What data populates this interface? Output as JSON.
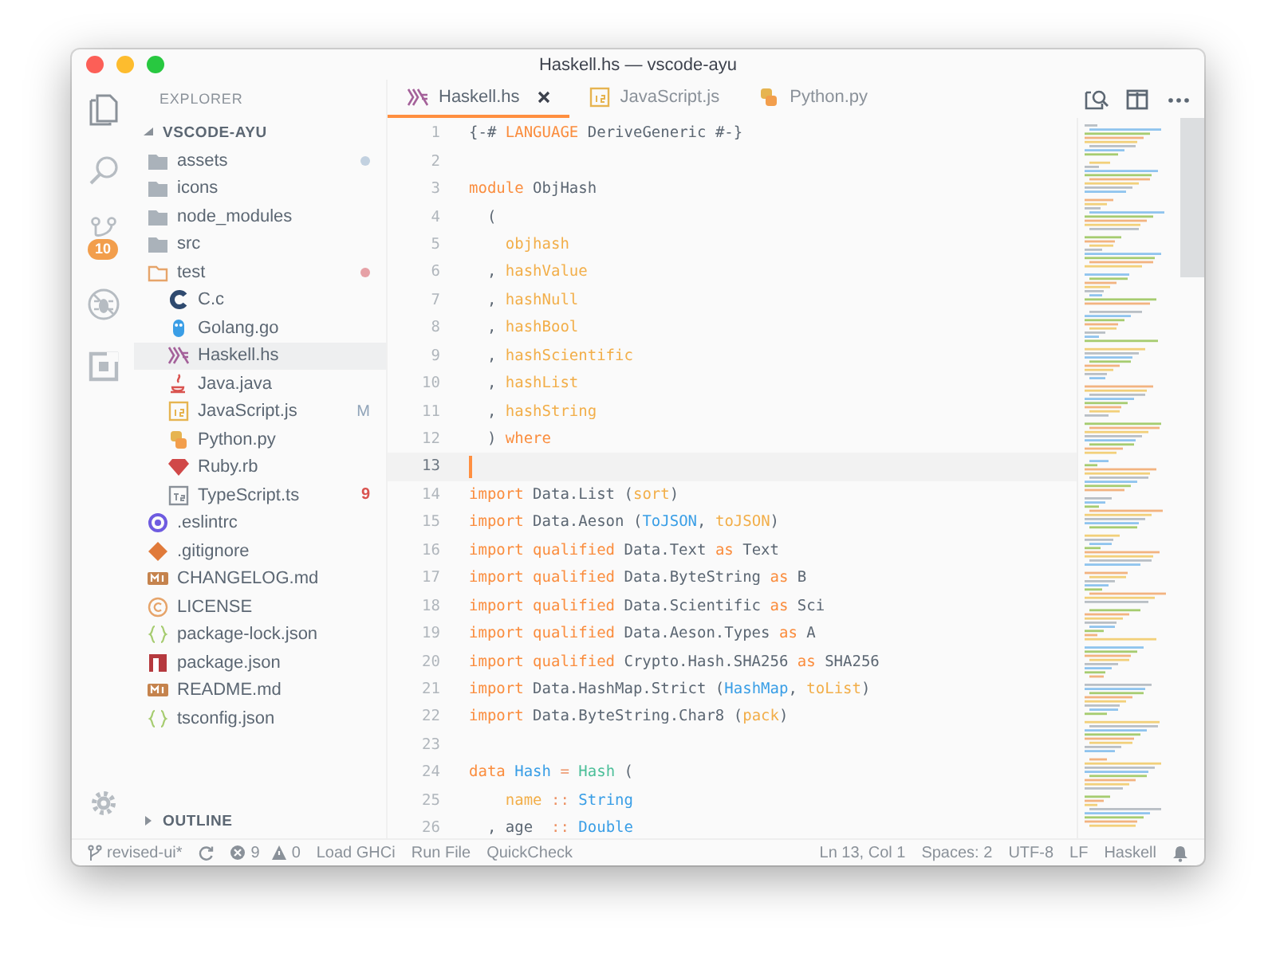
{
  "window": {
    "title": "Haskell.hs — vscode-ayu"
  },
  "activity_bar": {
    "items": [
      {
        "kind": "files",
        "selected": true
      },
      {
        "kind": "search",
        "selected": false
      },
      {
        "kind": "branch",
        "selected": false,
        "badge": "10"
      },
      {
        "kind": "debug",
        "selected": false
      },
      {
        "kind": "extensions",
        "selected": false
      }
    ]
  },
  "sidebar": {
    "header": "EXPLORER",
    "root": {
      "label": "VSCODE-AYU",
      "expanded": true
    },
    "items": [
      {
        "label": "assets",
        "kind": "folder",
        "expanded": false,
        "selected": false,
        "color": "#c2d1e0"
      },
      {
        "label": "icons",
        "kind": "folder",
        "expanded": false,
        "selected": false
      },
      {
        "label": "node_modules",
        "kind": "folder",
        "expanded": false,
        "selected": false
      },
      {
        "label": "src",
        "kind": "folder",
        "expanded": false,
        "selected": false
      },
      {
        "label": "test",
        "kind": "folder",
        "expanded": true,
        "selected": false,
        "color": "#e6a1a6",
        "children": [
          {
            "label": "C.c",
            "kind": "c",
            "selected": false
          },
          {
            "label": "Golang.go",
            "kind": "go",
            "selected": false
          },
          {
            "label": "Haskell.hs",
            "kind": "haskell",
            "selected": true
          },
          {
            "label": "Java.java",
            "kind": "java",
            "selected": false
          },
          {
            "label": "JavaScript.js",
            "kind": "js",
            "selected": false,
            "git_status": "M"
          },
          {
            "label": "Python.py",
            "kind": "python",
            "selected": false
          },
          {
            "label": "Ruby.rb",
            "kind": "ruby",
            "selected": false
          },
          {
            "label": "TypeScript.ts",
            "kind": "ts",
            "selected": false,
            "problems": "9"
          }
        ]
      },
      {
        "label": ".eslintrc",
        "kind": "eslint",
        "selected": false
      },
      {
        "label": ".gitignore",
        "kind": "git",
        "selected": false
      },
      {
        "label": "CHANGELOG.md",
        "kind": "markdown",
        "selected": false
      },
      {
        "label": "LICENSE",
        "kind": "license",
        "selected": false
      },
      {
        "label": "package-lock.json",
        "kind": "json",
        "selected": false
      },
      {
        "label": "package.json",
        "kind": "npm",
        "selected": false
      },
      {
        "label": "README.md",
        "kind": "markdown",
        "selected": false
      },
      {
        "label": "tsconfig.json",
        "kind": "json",
        "selected": false
      }
    ],
    "outline": {
      "label": "OUTLINE",
      "expanded": false
    }
  },
  "tabs": [
    {
      "label": "Haskell.hs",
      "kind": "haskell",
      "selected": true
    },
    {
      "label": "JavaScript.js",
      "kind": "js",
      "selected": false
    },
    {
      "label": "Python.py",
      "kind": "python",
      "selected": false
    }
  ],
  "code": [
    {
      "number": "1",
      "current": false,
      "tokens": [
        {
          "kind": "plain",
          "text": "{-# "
        },
        {
          "kind": "keyword",
          "text": "LANGUAGE"
        },
        {
          "kind": "plain",
          "text": " DeriveGeneric #-}"
        }
      ]
    },
    {
      "number": "2",
      "current": false
    },
    {
      "number": "3",
      "current": false,
      "tokens": [
        {
          "kind": "keyword",
          "text": "module"
        },
        {
          "kind": "plain",
          "text": " ObjHash"
        }
      ]
    },
    {
      "number": "4",
      "current": false,
      "tokens": [
        {
          "kind": "plain",
          "text": "  ("
        }
      ]
    },
    {
      "number": "5",
      "current": false,
      "tokens": [
        {
          "kind": "function",
          "text": "    objhash"
        }
      ]
    },
    {
      "number": "6",
      "current": false,
      "tokens": [
        {
          "kind": "plain",
          "text": "  , "
        },
        {
          "kind": "function",
          "text": "hashValue"
        }
      ]
    },
    {
      "number": "7",
      "current": false,
      "tokens": [
        {
          "kind": "plain",
          "text": "  , "
        },
        {
          "kind": "function",
          "text": "hashNull"
        }
      ]
    },
    {
      "number": "8",
      "current": false,
      "tokens": [
        {
          "kind": "plain",
          "text": "  , "
        },
        {
          "kind": "function",
          "text": "hashBool"
        }
      ]
    },
    {
      "number": "9",
      "current": false,
      "tokens": [
        {
          "kind": "plain",
          "text": "  , "
        },
        {
          "kind": "function",
          "text": "hashScientific"
        }
      ]
    },
    {
      "number": "10",
      "current": false,
      "tokens": [
        {
          "kind": "plain",
          "text": "  , "
        },
        {
          "kind": "function",
          "text": "hashList"
        }
      ]
    },
    {
      "number": "11",
      "current": false,
      "tokens": [
        {
          "kind": "plain",
          "text": "  , "
        },
        {
          "kind": "function",
          "text": "hashString"
        }
      ]
    },
    {
      "number": "12",
      "current": false,
      "tokens": [
        {
          "kind": "plain",
          "text": "  ) "
        },
        {
          "kind": "keyword",
          "text": "where"
        }
      ]
    },
    {
      "number": "13",
      "current": true
    },
    {
      "number": "14",
      "current": false,
      "tokens": [
        {
          "kind": "keyword",
          "text": "import"
        },
        {
          "kind": "plain",
          "text": " Data.List ("
        },
        {
          "kind": "function",
          "text": "sort"
        },
        {
          "kind": "plain",
          "text": ")"
        }
      ]
    },
    {
      "number": "15",
      "current": false,
      "tokens": [
        {
          "kind": "keyword",
          "text": "import"
        },
        {
          "kind": "plain",
          "text": " Data.Aeson ("
        },
        {
          "kind": "type",
          "text": "ToJSON"
        },
        {
          "kind": "plain",
          "text": ", "
        },
        {
          "kind": "function",
          "text": "toJSON"
        },
        {
          "kind": "plain",
          "text": ")"
        }
      ]
    },
    {
      "number": "16",
      "current": false,
      "tokens": [
        {
          "kind": "keyword",
          "text": "import qualified"
        },
        {
          "kind": "plain",
          "text": " Data.Text "
        },
        {
          "kind": "keyword",
          "text": "as"
        },
        {
          "kind": "plain",
          "text": " Text"
        }
      ]
    },
    {
      "number": "17",
      "current": false,
      "tokens": [
        {
          "kind": "keyword",
          "text": "import qualified"
        },
        {
          "kind": "plain",
          "text": " Data.ByteString "
        },
        {
          "kind": "keyword",
          "text": "as"
        },
        {
          "kind": "plain",
          "text": " B"
        }
      ]
    },
    {
      "number": "18",
      "current": false,
      "tokens": [
        {
          "kind": "keyword",
          "text": "import qualified"
        },
        {
          "kind": "plain",
          "text": " Data.Scientific "
        },
        {
          "kind": "keyword",
          "text": "as"
        },
        {
          "kind": "plain",
          "text": " Sci"
        }
      ]
    },
    {
      "number": "19",
      "current": false,
      "tokens": [
        {
          "kind": "keyword",
          "text": "import qualified"
        },
        {
          "kind": "plain",
          "text": " Data.Aeson.Types "
        },
        {
          "kind": "keyword",
          "text": "as"
        },
        {
          "kind": "plain",
          "text": " A"
        }
      ]
    },
    {
      "number": "20",
      "current": false,
      "tokens": [
        {
          "kind": "keyword",
          "text": "import qualified"
        },
        {
          "kind": "plain",
          "text": " Crypto.Hash.SHA256 "
        },
        {
          "kind": "keyword",
          "text": "as"
        },
        {
          "kind": "plain",
          "text": " SHA256"
        }
      ]
    },
    {
      "number": "21",
      "current": false,
      "tokens": [
        {
          "kind": "keyword",
          "text": "import"
        },
        {
          "kind": "plain",
          "text": " Data.HashMap.Strict ("
        },
        {
          "kind": "type",
          "text": "HashMap"
        },
        {
          "kind": "plain",
          "text": ", "
        },
        {
          "kind": "function",
          "text": "toList"
        },
        {
          "kind": "plain",
          "text": ")"
        }
      ]
    },
    {
      "number": "22",
      "current": false,
      "tokens": [
        {
          "kind": "keyword",
          "text": "import"
        },
        {
          "kind": "plain",
          "text": " Data.ByteString.Char8 ("
        },
        {
          "kind": "function",
          "text": "pack"
        },
        {
          "kind": "plain",
          "text": ")"
        }
      ]
    },
    {
      "number": "23",
      "current": false
    },
    {
      "number": "24",
      "current": false,
      "tokens": [
        {
          "kind": "keyword",
          "text": "data"
        },
        {
          "kind": "type",
          "text": " Hash"
        },
        {
          "kind": "operator",
          "text": " ="
        },
        {
          "kind": "constructor",
          "text": " Hash"
        },
        {
          "kind": "plain",
          "text": " ("
        }
      ]
    },
    {
      "number": "25",
      "current": false,
      "tokens": [
        {
          "kind": "function",
          "text": "    name"
        },
        {
          "kind": "operator",
          "text": " ::"
        },
        {
          "kind": "type",
          "text": " String"
        }
      ]
    },
    {
      "number": "26",
      "current": false,
      "tokens": [
        {
          "kind": "plain",
          "text": "  , age  "
        },
        {
          "kind": "operator",
          "text": "::"
        },
        {
          "kind": "type",
          "text": " Double"
        }
      ]
    }
  ],
  "status_bar": {
    "left": [
      {
        "kind": "branch",
        "text": "revised-ui*"
      },
      {
        "kind": "sync"
      },
      {
        "kind": "problems",
        "errors": "9",
        "warnings": "0"
      },
      {
        "kind": "text",
        "text": "Load GHCi"
      },
      {
        "kind": "text",
        "text": "Run File"
      },
      {
        "kind": "text",
        "text": "QuickCheck"
      }
    ],
    "right": [
      {
        "kind": "text",
        "text": "Ln 13, Col 1"
      },
      {
        "kind": "text",
        "text": "Spaces: 2"
      },
      {
        "kind": "text",
        "text": "UTF-8"
      },
      {
        "kind": "text",
        "text": "LF"
      },
      {
        "kind": "text",
        "text": "Haskell"
      },
      {
        "kind": "bell"
      }
    ]
  }
}
